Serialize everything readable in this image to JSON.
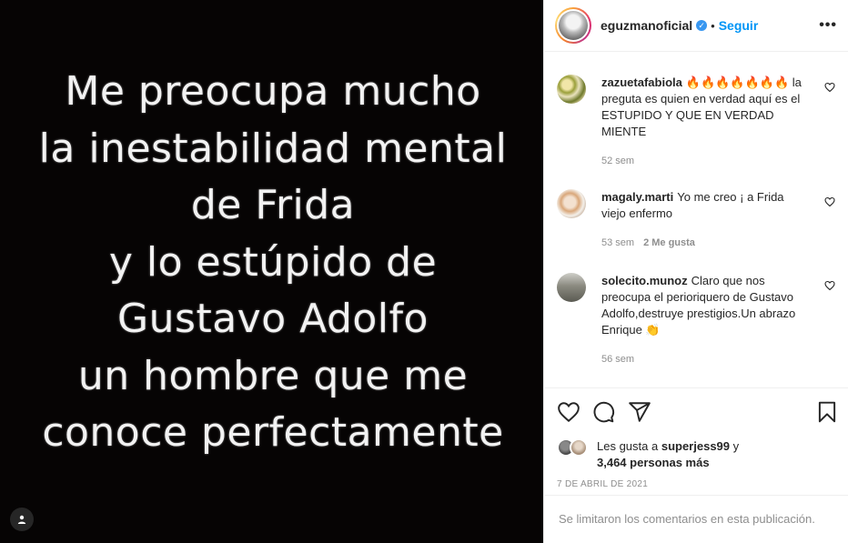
{
  "post": {
    "image_text_lines": [
      "Me preocupa mucho",
      "la inestabilidad mental",
      "de Frida",
      "y lo estúpido de",
      "Gustavo Adolfo",
      "un hombre que me",
      "conoce perfectamente"
    ],
    "tag_icon": "user-tag-icon"
  },
  "header": {
    "username": "eguzmanoficial",
    "verified_icon": "verified-badge-icon",
    "separator": "•",
    "follow_label": "Seguir",
    "more_label": "•••"
  },
  "comments": [
    {
      "user": "zazuetafabiola",
      "text": "🔥🔥🔥🔥🔥🔥🔥 la preguta es quien en verdad aquí es el ESTUPIDO Y QUE EN VERDAD MIENTE",
      "time": "52 sem",
      "likes": ""
    },
    {
      "user": "magaly.marti",
      "text": "Yo me creo ¡ a Frida viejo enfermo",
      "time": "53 sem",
      "likes": "2 Me gusta"
    },
    {
      "user": "solecito.munoz",
      "text": "Claro que nos preocupa el perioriquero de Gustavo Adolfo,destruye prestigios.Un abrazo Enrique 👏",
      "time": "56 sem",
      "likes": ""
    }
  ],
  "actions": {
    "like_icon": "heart-icon",
    "comment_icon": "comment-icon",
    "share_icon": "share-icon",
    "save_icon": "bookmark-icon"
  },
  "likes": {
    "prefix": "Les gusta a",
    "user": "superjess99",
    "middle": "y",
    "count": "3,464 personas más"
  },
  "date": "7 DE ABRIL DE 2021",
  "limited_comments": "Se limitaron los comentarios en esta publicación.",
  "colors": {
    "link": "#0095f6",
    "muted": "#8e8e8e",
    "media_bg": "#060404"
  }
}
